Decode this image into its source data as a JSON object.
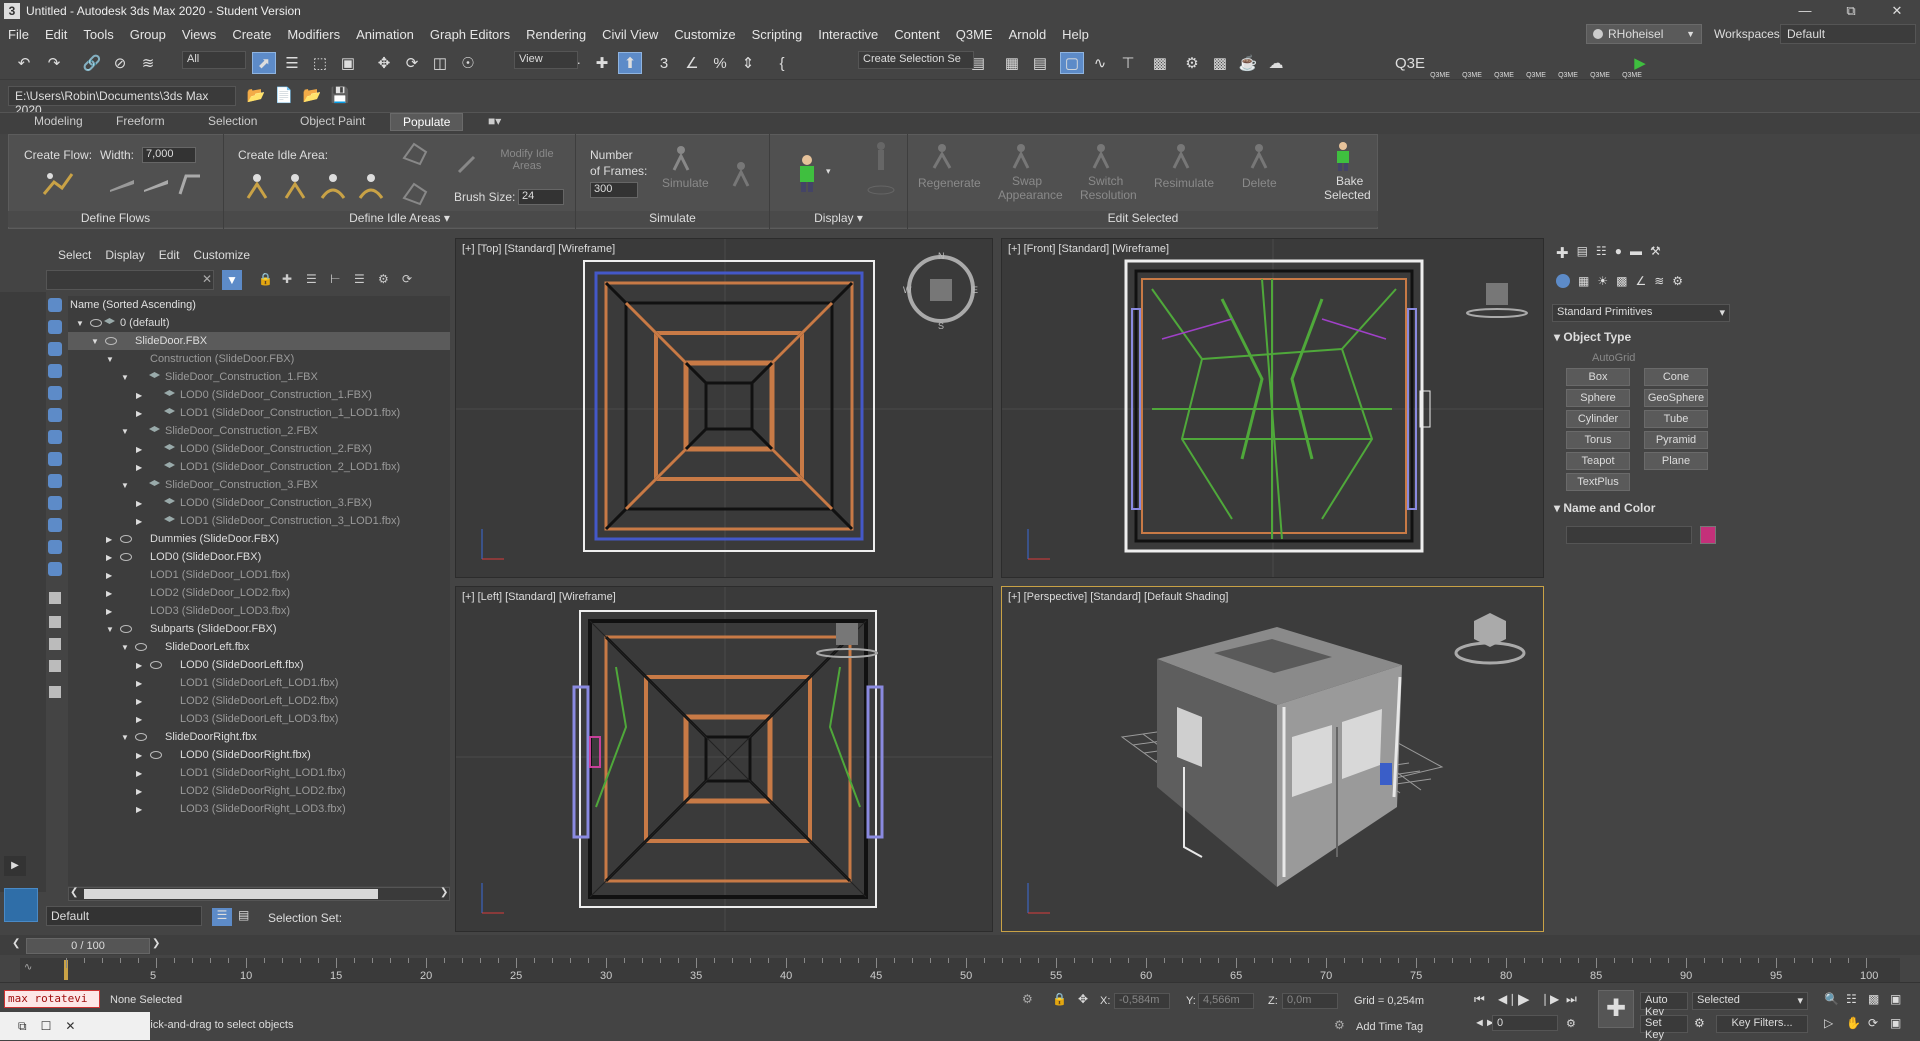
{
  "window": {
    "title": "Untitled - Autodesk 3ds Max 2020 - Student Version",
    "app_icon": "3"
  },
  "menu": [
    "Edit",
    "Tools",
    "Group",
    "Views",
    "Create",
    "Modifiers",
    "Animation",
    "Graph Editors",
    "Rendering",
    "Civil View",
    "Customize",
    "Scripting",
    "Interactive",
    "Content",
    "Q3ME",
    "Arnold",
    "Help"
  ],
  "menu_file_label": "File",
  "user": {
    "name": "RHoheisel"
  },
  "workspaces": {
    "label": "Workspaces:",
    "value": "Default"
  },
  "toolbar": {
    "filter_dd": "All",
    "refcoord_dd": "View",
    "selection_set_dd": "Create Selection Se",
    "q3me_export": "Q3E",
    "q3me_labels": [
      "Q3ME",
      "Q3ME",
      "Q3ME",
      "Q3ME",
      "Q3ME",
      "Q3ME",
      "Q3ME"
    ]
  },
  "project_path": "E:\\Users\\Robin\\Documents\\3ds Max 2020",
  "ribbon_tabs": [
    "Modeling",
    "Freeform",
    "Selection",
    "Object Paint",
    "Populate"
  ],
  "ribbon": {
    "define_flows": {
      "create_flow": "Create Flow:",
      "width_label": "Width:",
      "width_value": "7,000",
      "group_label": "Define Flows"
    },
    "define_idle": {
      "create_idle": "Create Idle Area:",
      "modify_idle": "Modify Idle Areas",
      "brush_label": "Brush Size:",
      "brush_value": "24",
      "group_label": "Define Idle Areas"
    },
    "simulate": {
      "frames_label_1": "Number",
      "frames_label_2": "of Frames:",
      "frames_value": "300",
      "simulate_btn": "Simulate",
      "group_label": "Simulate"
    },
    "display": {
      "group_label": "Display"
    },
    "edit_selected": {
      "regenerate": "Regenerate",
      "swap1": "Swap",
      "swap2": "Appearance",
      "switch1": "Switch",
      "switch2": "Resolution",
      "resimulate": "Resimulate",
      "delete": "Delete",
      "bake1": "Bake",
      "bake2": "Selected",
      "group_label": "Edit Selected"
    }
  },
  "scene_explorer": {
    "menu": [
      "Select",
      "Display",
      "Edit",
      "Customize"
    ],
    "column_header": "Name (Sorted Ascending)",
    "rows": [
      {
        "text": "0 (default)",
        "indent": 0,
        "eye": true,
        "tri": "down",
        "grey": false,
        "layer": true
      },
      {
        "text": "SlideDoor.FBX",
        "indent": 1,
        "eye": true,
        "tri": "down",
        "grey": false,
        "layer": false,
        "sel": true
      },
      {
        "text": "Construction (SlideDoor.FBX)",
        "indent": 2,
        "eye": false,
        "tri": "down",
        "grey": true,
        "layer": false
      },
      {
        "text": "SlideDoor_Construction_1.FBX",
        "indent": 3,
        "eye": false,
        "tri": "down",
        "grey": true,
        "layer": true
      },
      {
        "text": "LOD0 (SlideDoor_Construction_1.FBX)",
        "indent": 4,
        "eye": false,
        "tri": "right",
        "grey": true,
        "layer": true
      },
      {
        "text": "LOD1 (SlideDoor_Construction_1_LOD1.fbx)",
        "indent": 4,
        "eye": false,
        "tri": "right",
        "grey": true,
        "layer": true
      },
      {
        "text": "SlideDoor_Construction_2.FBX",
        "indent": 3,
        "eye": false,
        "tri": "down",
        "grey": true,
        "layer": true
      },
      {
        "text": "LOD0 (SlideDoor_Construction_2.FBX)",
        "indent": 4,
        "eye": false,
        "tri": "right",
        "grey": true,
        "layer": true
      },
      {
        "text": "LOD1 (SlideDoor_Construction_2_LOD1.fbx)",
        "indent": 4,
        "eye": false,
        "tri": "right",
        "grey": true,
        "layer": true
      },
      {
        "text": "SlideDoor_Construction_3.FBX",
        "indent": 3,
        "eye": false,
        "tri": "down",
        "grey": true,
        "layer": true
      },
      {
        "text": "LOD0 (SlideDoor_Construction_3.FBX)",
        "indent": 4,
        "eye": false,
        "tri": "right",
        "grey": true,
        "layer": true
      },
      {
        "text": "LOD1 (SlideDoor_Construction_3_LOD1.fbx)",
        "indent": 4,
        "eye": false,
        "tri": "right",
        "grey": true,
        "layer": true
      },
      {
        "text": "Dummies (SlideDoor.FBX)",
        "indent": 2,
        "eye": true,
        "tri": "right",
        "grey": false,
        "layer": false
      },
      {
        "text": "LOD0 (SlideDoor.FBX)",
        "indent": 2,
        "eye": true,
        "tri": "right",
        "grey": false,
        "layer": false
      },
      {
        "text": "LOD1 (SlideDoor_LOD1.fbx)",
        "indent": 2,
        "eye": false,
        "tri": "right",
        "grey": true,
        "layer": false
      },
      {
        "text": "LOD2 (SlideDoor_LOD2.fbx)",
        "indent": 2,
        "eye": false,
        "tri": "right",
        "grey": true,
        "layer": false
      },
      {
        "text": "LOD3 (SlideDoor_LOD3.fbx)",
        "indent": 2,
        "eye": false,
        "tri": "right",
        "grey": true,
        "layer": false
      },
      {
        "text": "Subparts (SlideDoor.FBX)",
        "indent": 2,
        "eye": true,
        "tri": "down",
        "grey": false,
        "layer": false
      },
      {
        "text": "SlideDoorLeft.fbx",
        "indent": 3,
        "eye": true,
        "tri": "down",
        "grey": false,
        "layer": false
      },
      {
        "text": "LOD0 (SlideDoorLeft.fbx)",
        "indent": 4,
        "eye": true,
        "tri": "right",
        "grey": false,
        "layer": false
      },
      {
        "text": "LOD1 (SlideDoorLeft_LOD1.fbx)",
        "indent": 4,
        "eye": false,
        "tri": "right",
        "grey": true,
        "layer": false
      },
      {
        "text": "LOD2 (SlideDoorLeft_LOD2.fbx)",
        "indent": 4,
        "eye": false,
        "tri": "right",
        "grey": true,
        "layer": false
      },
      {
        "text": "LOD3 (SlideDoorLeft_LOD3.fbx)",
        "indent": 4,
        "eye": false,
        "tri": "right",
        "grey": true,
        "layer": false
      },
      {
        "text": "SlideDoorRight.fbx",
        "indent": 3,
        "eye": true,
        "tri": "down",
        "grey": false,
        "layer": false
      },
      {
        "text": "LOD0 (SlideDoorRight.fbx)",
        "indent": 4,
        "eye": true,
        "tri": "right",
        "grey": false,
        "layer": false
      },
      {
        "text": "LOD1 (SlideDoorRight_LOD1.fbx)",
        "indent": 4,
        "eye": false,
        "tri": "right",
        "grey": true,
        "layer": false
      },
      {
        "text": "LOD2 (SlideDoorRight_LOD2.fbx)",
        "indent": 4,
        "eye": false,
        "tri": "right",
        "grey": true,
        "layer": false
      },
      {
        "text": "LOD3 (SlideDoorRight_LOD3.fbx)",
        "indent": 4,
        "eye": false,
        "tri": "right",
        "grey": true,
        "layer": false
      }
    ],
    "layer_dd": "Default",
    "selection_set_label": "Selection Set:"
  },
  "viewports": {
    "top": "[+] [Top] [Standard] [Wireframe]",
    "front": "[+] [Front] [Standard] [Wireframe]",
    "left": "[+] [Left] [Standard] [Wireframe]",
    "perspective": "[+] [Perspective] [Standard] [Default Shading]"
  },
  "command_panel": {
    "category_dd": "Standard Primitives",
    "object_type_header": "Object Type",
    "autogrid": "AutoGrid",
    "primitives": [
      "Box",
      "Cone",
      "Sphere",
      "GeoSphere",
      "Cylinder",
      "Tube",
      "Torus",
      "Pyramid",
      "Teapot",
      "Plane",
      "TextPlus"
    ],
    "name_color_header": "Name and Color",
    "object_color": "#c4307a"
  },
  "timeline": {
    "slider_text": "0 / 100",
    "ticks": [
      0,
      5,
      10,
      15,
      20,
      25,
      30,
      35,
      40,
      45,
      50,
      55,
      60,
      65,
      70,
      75,
      80,
      85,
      90,
      95,
      100
    ]
  },
  "status": {
    "maxscript": "max rotatevi",
    "none_selected": "None Selected",
    "prompt": "Click-and-drag to select objects",
    "x_label": "X:",
    "x_value": "-0,584m",
    "y_label": "Y:",
    "y_value": "4,566m",
    "z_label": "Z:",
    "z_value": "0,0m",
    "grid": "Grid = 0,254m",
    "add_time_tag": "Add Time Tag",
    "auto_key": "Auto Key",
    "selected_dd": "Selected",
    "set_key": "Set Key",
    "key_filters": "Key Filters...",
    "frame_value": "0"
  }
}
